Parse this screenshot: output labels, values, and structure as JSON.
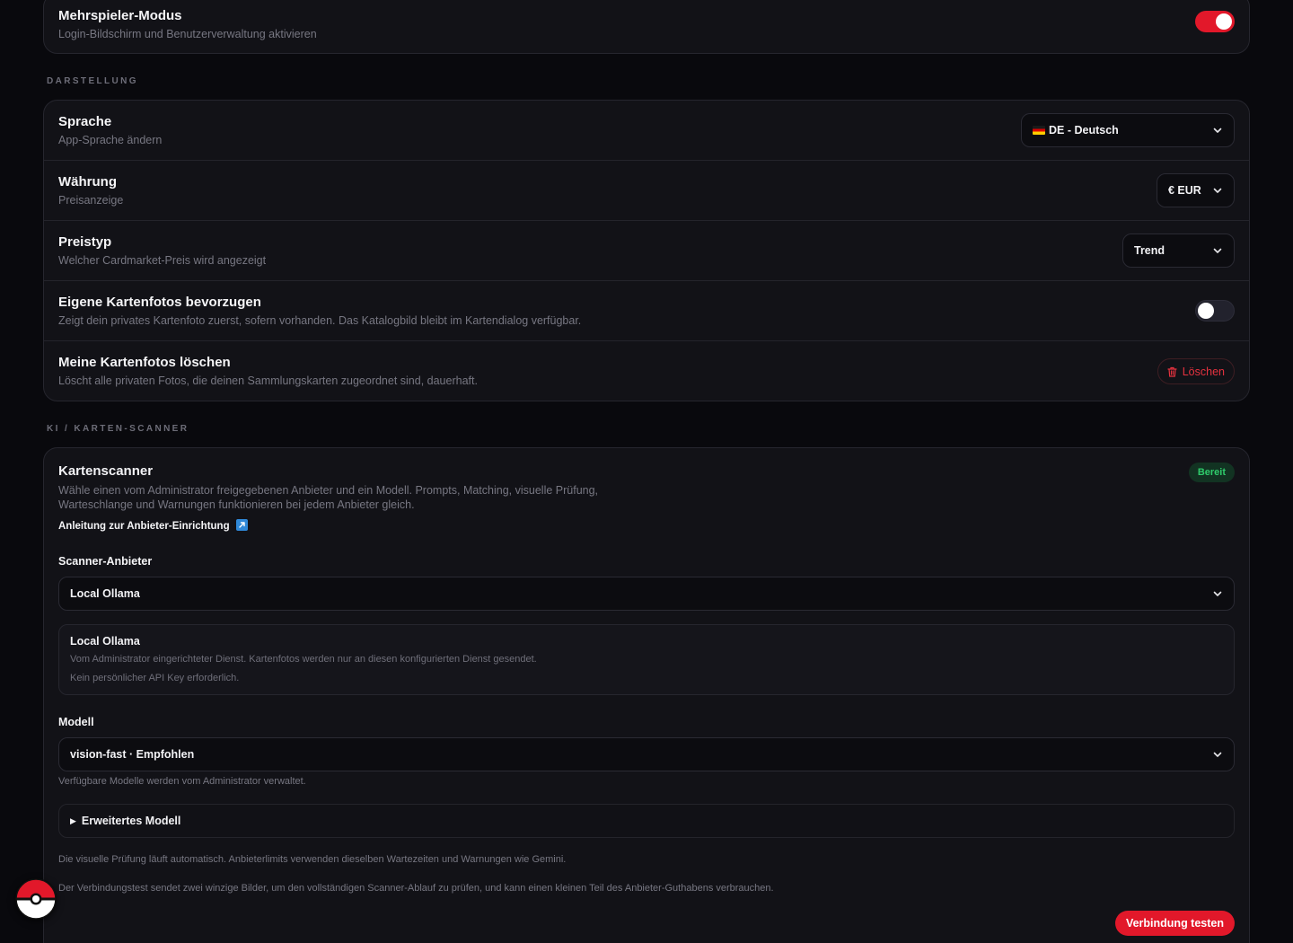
{
  "multiplayer": {
    "title": "Mehrspieler-Modus",
    "description": "Login-Bildschirm und Benutzerverwaltung aktivieren",
    "enabled": true
  },
  "display_section": {
    "label": "DARSTELLUNG",
    "language": {
      "title": "Sprache",
      "description": "App-Sprache ändern",
      "value": "DE - Deutsch"
    },
    "currency": {
      "title": "Währung",
      "description": "Preisanzeige",
      "value": "€ EUR"
    },
    "price_type": {
      "title": "Preistyp",
      "description": "Welcher Cardmarket-Preis wird angezeigt",
      "value": "Trend"
    },
    "own_photos": {
      "title": "Eigene Kartenfotos bevorzugen",
      "description": "Zeigt dein privates Kartenfoto zuerst, sofern vorhanden. Das Katalogbild bleibt im Kartendialog verfügbar.",
      "enabled": false
    },
    "delete_photos": {
      "title": "Meine Kartenfotos löschen",
      "description": "Löscht alle privaten Fotos, die deinen Sammlungskarten zugeordnet sind, dauerhaft.",
      "button": "Löschen"
    }
  },
  "scanner_section": {
    "label": "KI / KARTEN-SCANNER",
    "title": "Kartenscanner",
    "status": "Bereit",
    "description": "Wähle einen vom Administrator freigegebenen Anbieter und ein Modell. Prompts, Matching, visuelle Prüfung, Warteschlange und Warnungen funktionieren bei jedem Anbieter gleich.",
    "guide_link": "Anleitung zur Anbieter-Einrichtung",
    "provider_label": "Scanner-Anbieter",
    "provider_value": "Local Ollama",
    "provider_info": {
      "title": "Local Ollama",
      "line1": "Vom Administrator eingerichteter Dienst. Kartenfotos werden nur an diesen konfigurierten Dienst gesendet.",
      "line2": "Kein persönlicher API Key erforderlich."
    },
    "model_label": "Modell",
    "model_value": "vision-fast · Empfohlen",
    "model_hint": "Verfügbare Modelle werden vom Administrator verwaltet.",
    "advanced_model": "Erweitertes Modell",
    "note_visual": "Die visuelle Prüfung läuft automatisch. Anbieterlimits verwenden dieselben Wartezeiten und Warnungen wie Gemini.",
    "note_test": "Der Verbindungstest sendet zwei winzige Bilder, um den vollständigen Scanner-Ablauf zu prüfen, und kann einen kleinen Teil des Anbieter-Guthabens verbrauchen.",
    "test_button": "Verbindung testen"
  },
  "icons": {
    "chevron": "chevron-down-icon",
    "trash": "trash-icon",
    "external": "external-link-icon",
    "pokeball": "pokeball-icon"
  },
  "colors": {
    "accent": "#e2182a",
    "success": "#2fcb6b",
    "background": "#09090d",
    "card": "#121217"
  }
}
